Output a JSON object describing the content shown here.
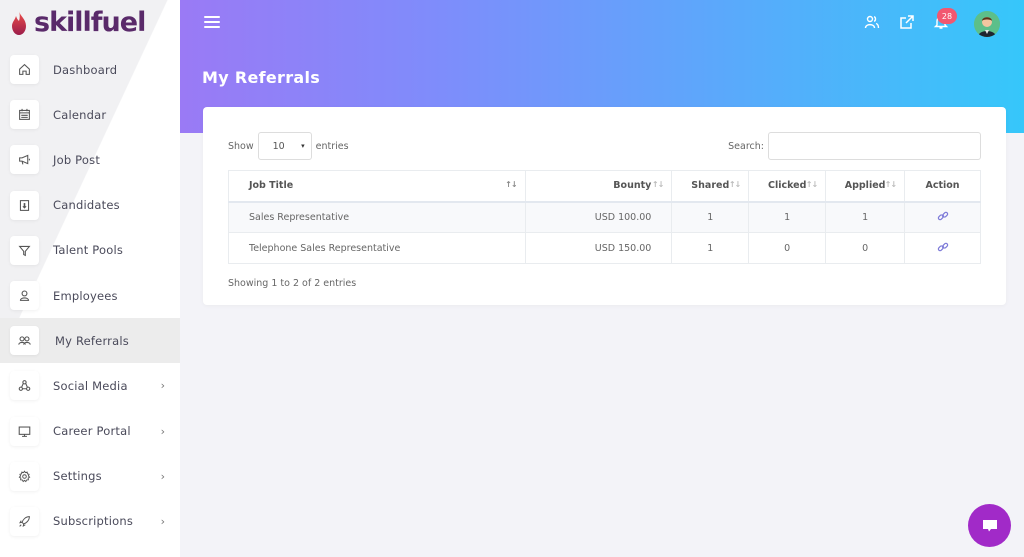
{
  "brand": {
    "name_part1": "skill",
    "name_part2": "fuel"
  },
  "sidebar": {
    "items": [
      {
        "label": "Dashboard",
        "icon": "home-icon",
        "has_submenu": false,
        "active": false
      },
      {
        "label": "Calendar",
        "icon": "calendar-icon",
        "has_submenu": false,
        "active": false
      },
      {
        "label": "Job Post",
        "icon": "megaphone-icon",
        "has_submenu": false,
        "active": false
      },
      {
        "label": "Candidates",
        "icon": "id-card-icon",
        "has_submenu": false,
        "active": false
      },
      {
        "label": "Talent Pools",
        "icon": "filter-icon",
        "has_submenu": false,
        "active": false
      },
      {
        "label": "Employees",
        "icon": "user-icon",
        "has_submenu": false,
        "active": false
      },
      {
        "label": "My Referrals",
        "icon": "users-icon",
        "has_submenu": false,
        "active": true
      },
      {
        "label": "Social Media",
        "icon": "social-network-icon",
        "has_submenu": true,
        "active": false
      },
      {
        "label": "Career Portal",
        "icon": "monitor-icon",
        "has_submenu": true,
        "active": false
      },
      {
        "label": "Settings",
        "icon": "gear-icon",
        "has_submenu": true,
        "active": false
      },
      {
        "label": "Subscriptions",
        "icon": "rocket-icon",
        "has_submenu": true,
        "active": false
      }
    ],
    "chevron": "›"
  },
  "header": {
    "page_title": "My Referrals",
    "notification_count": "28",
    "colors": {
      "gradient_start": "#9a7af5",
      "gradient_end": "#36c7fa",
      "badge": "#f25770"
    }
  },
  "table_controls": {
    "show_label": "Show",
    "entries_value": "10",
    "entries_label": "entries",
    "search_label": "Search:",
    "search_value": "",
    "caret": "▾"
  },
  "table": {
    "columns": [
      "Job Title",
      "Bounty",
      "Shared",
      "Clicked",
      "Applied",
      "Action"
    ],
    "sort_glyph": "↑↓",
    "rows": [
      {
        "job_title": "Sales Representative",
        "bounty": "USD 100.00",
        "shared": "1",
        "clicked": "1",
        "applied": "1",
        "action": "link-icon"
      },
      {
        "job_title": "Telephone Sales Representative",
        "bounty": "USD 150.00",
        "shared": "1",
        "clicked": "0",
        "applied": "0",
        "action": "link-icon"
      }
    ],
    "info": "Showing 1 to 2 of 2 entries"
  },
  "chat": {
    "color": "#a12ac8"
  }
}
